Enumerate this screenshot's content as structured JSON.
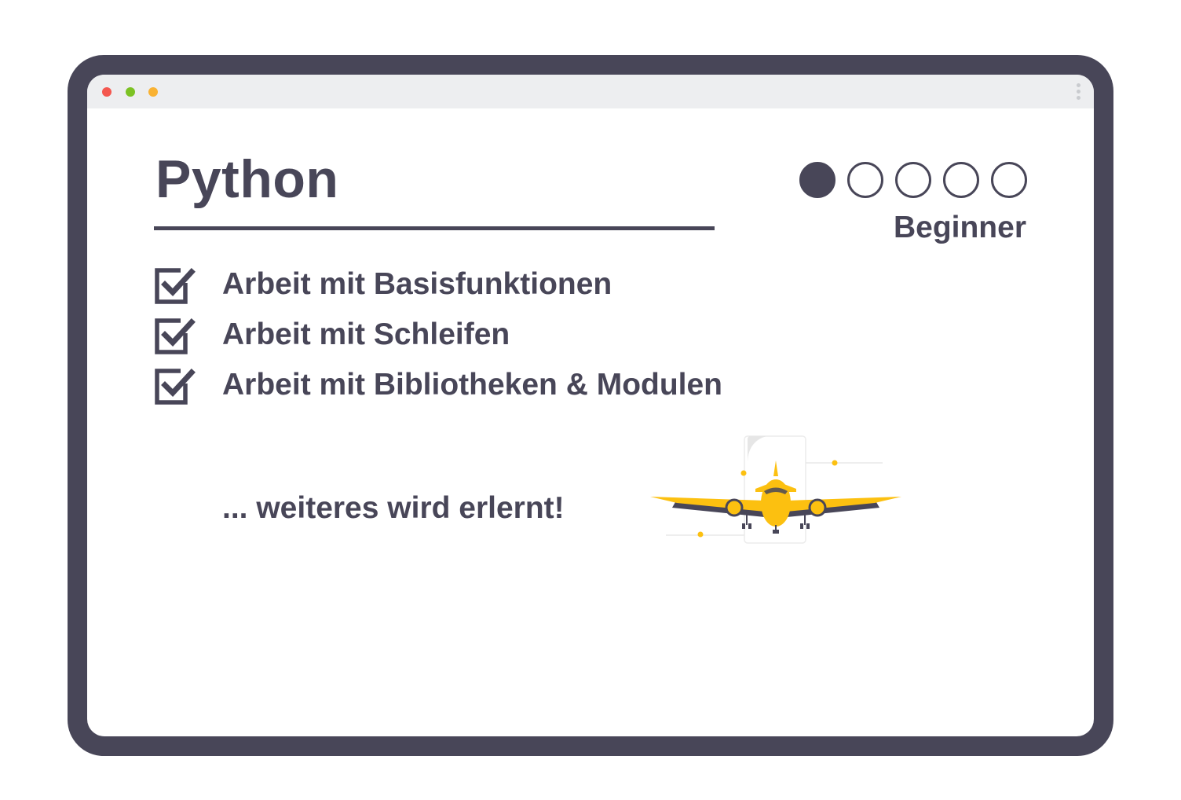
{
  "window": {
    "controls": [
      "close",
      "minimize",
      "maximize"
    ],
    "control_colors": {
      "close": "#f4574f",
      "minimize": "#7cc224",
      "maximize": "#f9b233"
    },
    "menu_icon": "kebab-menu-icon"
  },
  "course": {
    "title": "Python",
    "level": {
      "label": "Beginner",
      "value": 1,
      "max": 5
    },
    "topics": [
      {
        "label": "Arbeit mit Basisfunktionen",
        "checked": true,
        "icon": "checkbox-checked-icon"
      },
      {
        "label": "Arbeit mit Schleifen",
        "checked": true,
        "icon": "checkbox-checked-icon"
      },
      {
        "label": "Arbeit mit Bibliotheken & Modulen",
        "checked": true,
        "icon": "checkbox-checked-icon"
      }
    ],
    "more_text": "... weiteres wird erlernt!",
    "illustration": "airplane-illustration"
  },
  "colors": {
    "primary": "#484658",
    "accent": "#fcc010",
    "background": "#ffffff",
    "titlebar": "#edeef0"
  }
}
